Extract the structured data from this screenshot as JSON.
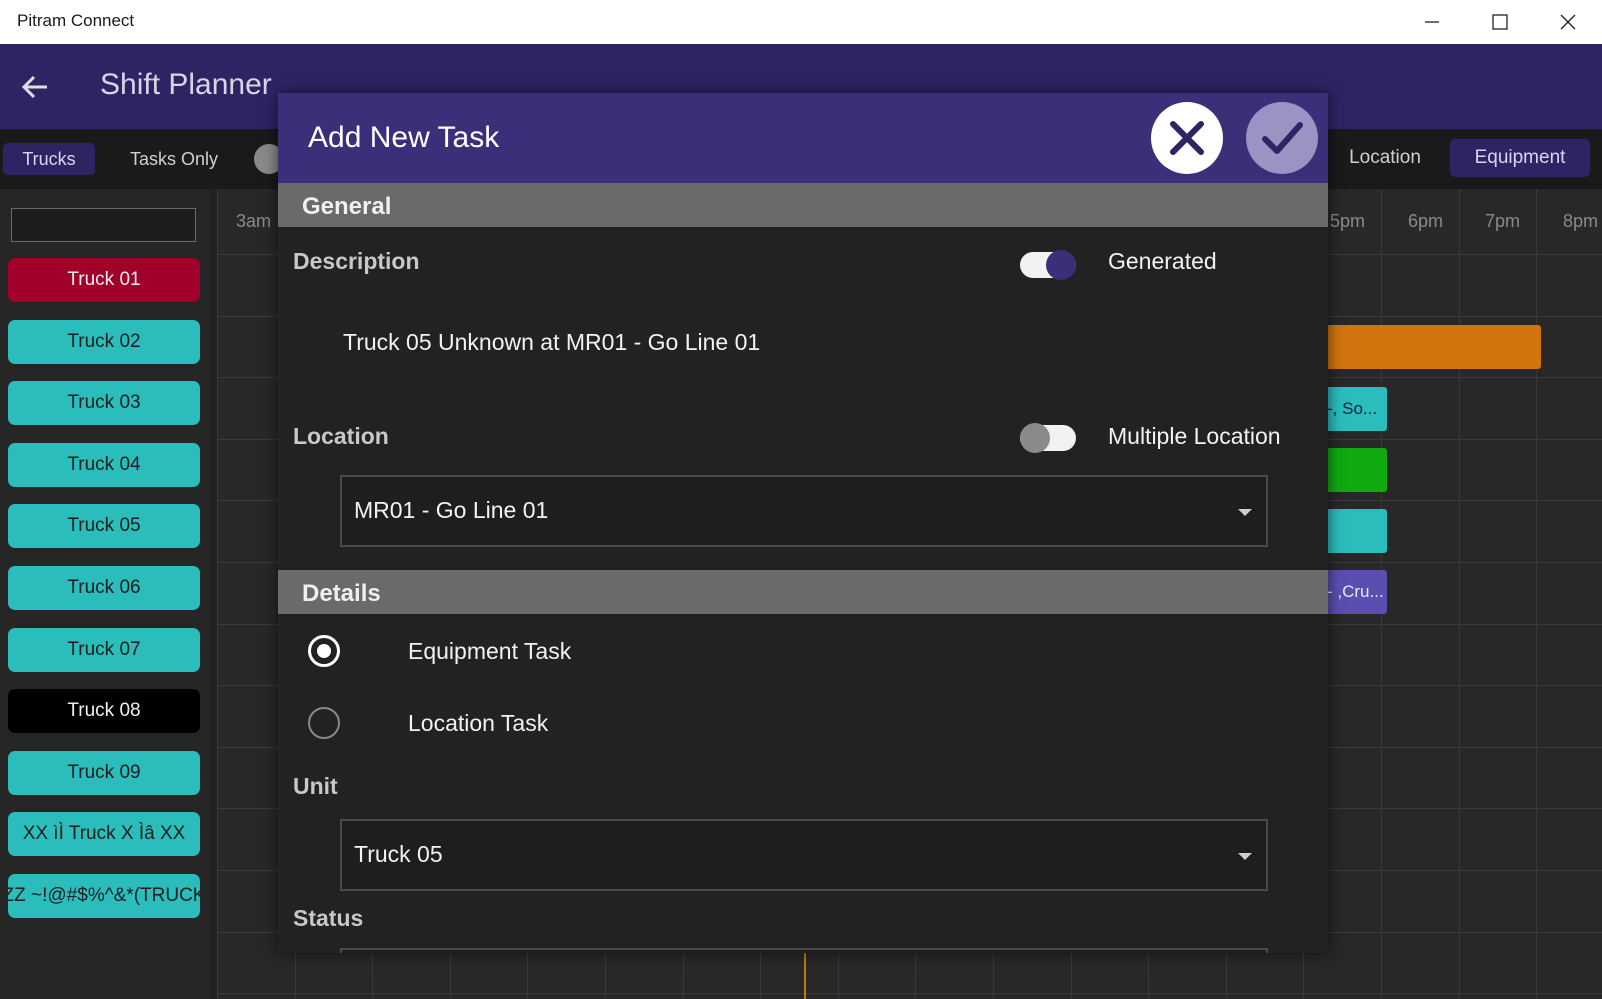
{
  "window": {
    "title": "Pitram Connect"
  },
  "appbar": {
    "title": "Shift Planner"
  },
  "toolbar": {
    "trucks_label": "Trucks",
    "tasks_only_label": "Tasks Only",
    "location_label": "Location",
    "equipment_label": "Equipment"
  },
  "sidebar": {
    "trucks": [
      {
        "label": "Truck 01",
        "color": "#a0002a",
        "text_color": "#f0f0f0"
      },
      {
        "label": "Truck 02",
        "color": "#2bbcbc",
        "text_color": "#1e1e1e"
      },
      {
        "label": "Truck 03",
        "color": "#2bbcbc",
        "text_color": "#1e1e1e"
      },
      {
        "label": "Truck 04",
        "color": "#2bbcbc",
        "text_color": "#1e1e1e"
      },
      {
        "label": "Truck 05",
        "color": "#2bbcbc",
        "text_color": "#1e1e1e"
      },
      {
        "label": "Truck 06",
        "color": "#2bbcbc",
        "text_color": "#1e1e1e"
      },
      {
        "label": "Truck 07",
        "color": "#2bbcbc",
        "text_color": "#1e1e1e"
      },
      {
        "label": "Truck 08",
        "color": "#000000",
        "text_color": "#f0f0f0"
      },
      {
        "label": "Truck 09",
        "color": "#2bbcbc",
        "text_color": "#1e1e1e"
      },
      {
        "label": "XX ìÌ Truck X Ìâ XX",
        "color": "#2bbcbc",
        "text_color": "#1e1e1e"
      },
      {
        "label": "ZZ ~!@#$%^&*(TRUCK",
        "color": "#2bbcbc",
        "text_color": "#1e1e1e"
      }
    ]
  },
  "timeline": {
    "hours": [
      "3am",
      "5pm",
      "6pm",
      "7pm",
      "8pm"
    ],
    "bars": [
      {
        "text": "",
        "color": "#d2740e"
      },
      {
        "text": "-, So...",
        "color": "#2bbcbc"
      },
      {
        "text": "",
        "color": "#11aa11"
      },
      {
        "text": "",
        "color": "#2bbcbc"
      },
      {
        "text": "- ,Cru...",
        "color": "#5a4fb0"
      }
    ]
  },
  "dialog": {
    "title": "Add New Task",
    "general": {
      "section_label": "General",
      "description_label": "Description",
      "generated_label": "Generated",
      "generated_on": true,
      "description_value": "Truck 05 Unknown at MR01 - Go Line 01",
      "location_label": "Location",
      "multiple_location_label": "Multiple Location",
      "multiple_location_on": false,
      "location_value": "MR01 - Go Line 01"
    },
    "details": {
      "section_label": "Details",
      "equipment_task_label": "Equipment Task",
      "location_task_label": "Location Task",
      "selected": "equipment",
      "unit_label": "Unit",
      "unit_value": "Truck 05",
      "status_label": "Status"
    }
  },
  "colors": {
    "accent": "#2e2464",
    "dialog_header": "#3a2f78"
  }
}
